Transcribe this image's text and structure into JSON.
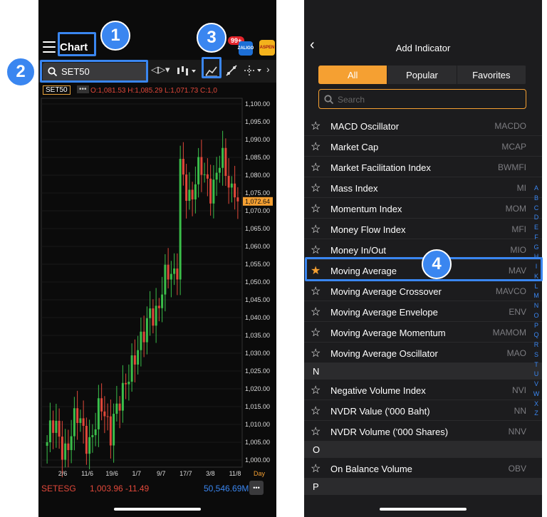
{
  "left": {
    "header": {
      "title": "Chart"
    },
    "notifications": {
      "count": "99+"
    },
    "app_icons": [
      "ZALIGO",
      "ASPEN"
    ],
    "search": {
      "symbol": "SET50"
    },
    "info": {
      "symbol": "SET50",
      "ohlc": "O:1,081.53 H:1,085.29 L:1,071.73 C:1,0"
    },
    "chart_data": {
      "type": "candlestick",
      "yticks": [
        "1,100.00",
        "1,095.00",
        "1,090.00",
        "1,085.00",
        "1,080.00",
        "1,075.00",
        "1,070.00",
        "1,065.00",
        "1,060.00",
        "1,055.00",
        "1,050.00",
        "1,045.00",
        "1,040.00",
        "1,035.00",
        "1,030.00",
        "1,025.00",
        "1,020.00",
        "1,015.00",
        "1,010.00",
        "1,005.00",
        "1,000.00"
      ],
      "ylim": [
        1000,
        1100
      ],
      "last_price": "1,072.64",
      "last_value": 1072.64,
      "xticks": [
        "2/6",
        "11/6",
        "19/6",
        "1/7",
        "9/7",
        "17/7",
        "3/8",
        "11/8"
      ],
      "period": "Day"
    },
    "footer": {
      "symbol": "SETESG",
      "change": "1,003.96 -11.49",
      "volume": "50,546.69M"
    }
  },
  "right": {
    "title": "Add Indicator",
    "tabs": [
      "All",
      "Popular",
      "Favorites"
    ],
    "search_placeholder": "Search",
    "items": [
      {
        "name": "MACD Oscillator",
        "code": "MACDO"
      },
      {
        "name": "Market Cap",
        "code": "MCAP"
      },
      {
        "name": "Market Facilitation Index",
        "code": "BWMFI"
      },
      {
        "name": "Mass Index",
        "code": "MI"
      },
      {
        "name": "Momentum Index",
        "code": "MOM"
      },
      {
        "name": "Money Flow Index",
        "code": "MFI"
      },
      {
        "name": "Money In/Out",
        "code": "MIO"
      },
      {
        "name": "Moving Average",
        "code": "MAV"
      },
      {
        "name": "Moving Average Crossover",
        "code": "MAVCO"
      },
      {
        "name": "Moving Average Envelope",
        "code": "ENV"
      },
      {
        "name": "Moving Average Momentum",
        "code": "MAMOM"
      },
      {
        "name": "Moving Average Oscillator",
        "code": "MAO"
      }
    ],
    "section_n": "N",
    "items_n": [
      {
        "name": "Negative Volume Index",
        "code": "NVI"
      },
      {
        "name": "NVDR Value ('000 Baht)",
        "code": "NN"
      },
      {
        "name": "NVDR Volume ('000 Shares)",
        "code": "NNV"
      }
    ],
    "section_o": "O",
    "items_o": [
      {
        "name": "On Balance Volume",
        "code": "OBV"
      }
    ],
    "section_p": "P",
    "index_letters": [
      "A",
      "B",
      "C",
      "D",
      "E",
      "F",
      "G",
      "H",
      "I",
      "K",
      "L",
      "M",
      "N",
      "O",
      "P",
      "Q",
      "R",
      "S",
      "T",
      "U",
      "V",
      "W",
      "X",
      "Z"
    ]
  },
  "callouts": [
    "1",
    "2",
    "3",
    "4"
  ],
  "colors": {
    "accent": "#f5a032",
    "highlight": "#3a86f0",
    "up": "#3bbf4a",
    "down": "#e2483a"
  }
}
